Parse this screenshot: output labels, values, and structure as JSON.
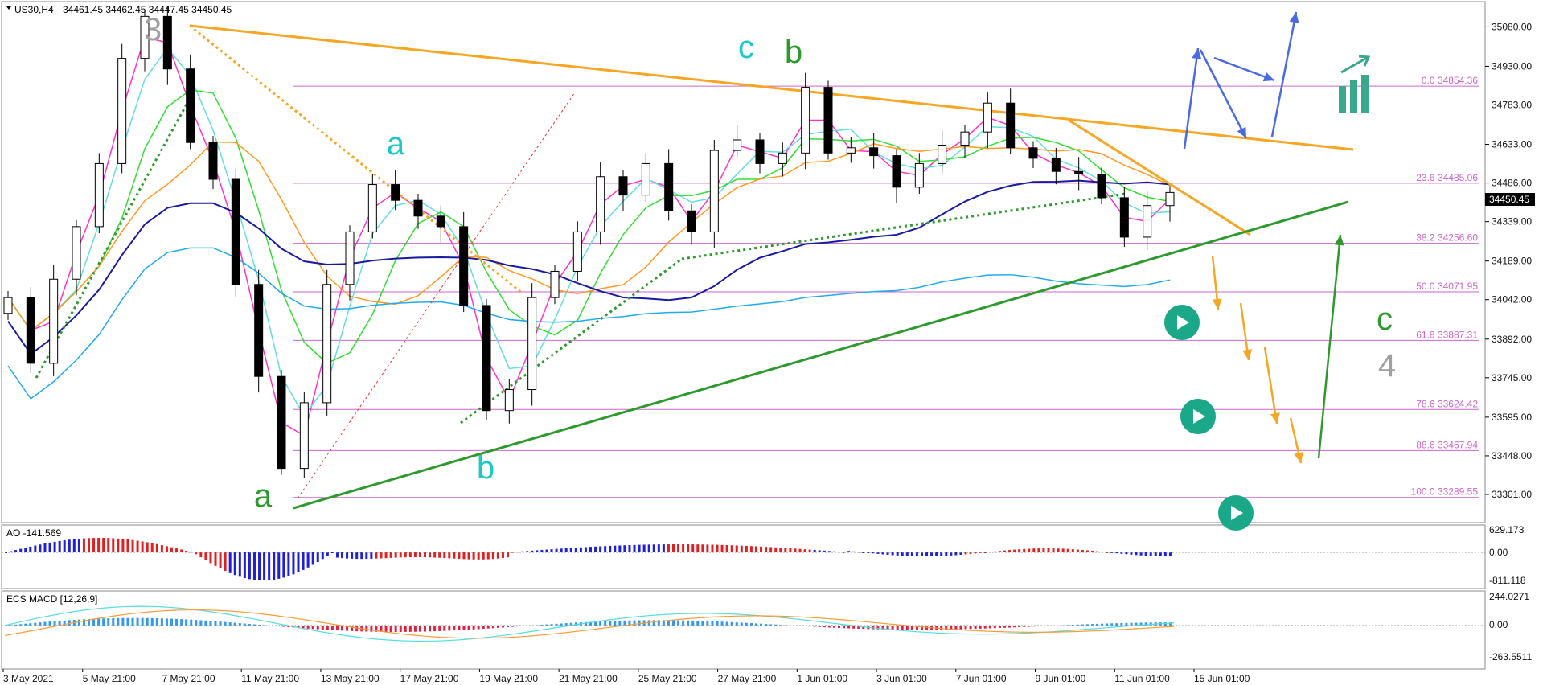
{
  "header": {
    "symbol": "US30,H4",
    "ohlc": "34461.45 34462.45 34447.45 34450.45"
  },
  "price_axis": {
    "ticks": [
      "35080.00",
      "34930.00",
      "34783.00",
      "34633.00",
      "34486.00",
      "34339.00",
      "34189.00",
      "34042.00",
      "33892.00",
      "33745.00",
      "33595.00",
      "33448.00",
      "33301.00"
    ],
    "current_price": "34450.45"
  },
  "time_axis": {
    "labels": [
      "3 May 2021",
      "5 May 21:00",
      "7 May 21:00",
      "11 May 21:00",
      "13 May 21:00",
      "17 May 21:00",
      "19 May 21:00",
      "21 May 21:00",
      "25 May 21:00",
      "27 May 21:00",
      "1 Jun 01:00",
      "3 Jun 01:00",
      "7 Jun 01:00",
      "9 Jun 01:00",
      "11 Jun 01:00",
      "15 Jun 01:00"
    ]
  },
  "fib_levels": [
    {
      "label": "0.0 34854.36",
      "price": 34854.36
    },
    {
      "label": "23.6 34485.06",
      "price": 34485.06
    },
    {
      "label": "38.2 34256.60",
      "price": 34256.6
    },
    {
      "label": "50.0 34071.95",
      "price": 34071.95
    },
    {
      "label": "61.8 33887.31",
      "price": 33887.31
    },
    {
      "label": "78.6 33624.42",
      "price": 33624.42
    },
    {
      "label": "88.6 33467.94",
      "price": 33467.94
    },
    {
      "label": "100.0 33289.55",
      "price": 33289.55
    }
  ],
  "wave_labels": [
    {
      "text": "3",
      "color": "#a0a0a0"
    },
    {
      "text": "a",
      "color": "#1fc8c8"
    },
    {
      "text": "c",
      "color": "#1fc8c8"
    },
    {
      "text": "b",
      "color": "#2e9a2e"
    },
    {
      "text": "a",
      "color": "#2e9a2e"
    },
    {
      "text": "b",
      "color": "#1fc8c8"
    },
    {
      "text": "c",
      "color": "#2e9a2e"
    },
    {
      "text": "4",
      "color": "#a0a0a0"
    }
  ],
  "ao_panel": {
    "title": "AO -141.569",
    "ticks": [
      "629.173",
      "0.00",
      "-811.118"
    ]
  },
  "macd_panel": {
    "title": "ECS MACD [12,26,9]",
    "ticks": [
      "244.0271",
      "0.00",
      "-263.5511"
    ]
  },
  "colors": {
    "up_candle": "#ffffff",
    "down_candle": "#000000",
    "orange_trend": "#f5a623",
    "green_trend": "#2e9a2e",
    "fib": "#cc66cc",
    "ao_up": "#1f1fd6",
    "ao_down": "#e02020",
    "play_button": "#1aa889",
    "blue_arrows": "#4a6ae0"
  },
  "chart_data": {
    "type": "candlestick",
    "title": "",
    "series_name": "US30,H4",
    "ylim": [
      33200,
      35170
    ],
    "current_price": 34450.45,
    "approximate_closes": [
      34050,
      33800,
      34120,
      34320,
      34560,
      34960,
      35120,
      34920,
      34640,
      34500,
      34100,
      33750,
      33400,
      33650,
      34100,
      34300,
      34480,
      34420,
      34360,
      34320,
      34020,
      33620,
      33700,
      34050,
      34150,
      34300,
      34510,
      34440,
      34560,
      34380,
      34300,
      34610,
      34650,
      34560,
      34600,
      34850,
      34600,
      34620,
      34590,
      34470,
      34560,
      34630,
      34680,
      34790,
      34620,
      34580,
      34530,
      34520,
      34430,
      34280,
      34400,
      34450
    ],
    "fib_retracement": {
      "0.0": 34854.36,
      "23.6": 34485.06,
      "38.2": 34256.6,
      "50.0": 34071.95,
      "61.8": 33887.31,
      "78.6": 33624.42,
      "88.6": 33467.94,
      "100.0": 33289.55
    }
  }
}
